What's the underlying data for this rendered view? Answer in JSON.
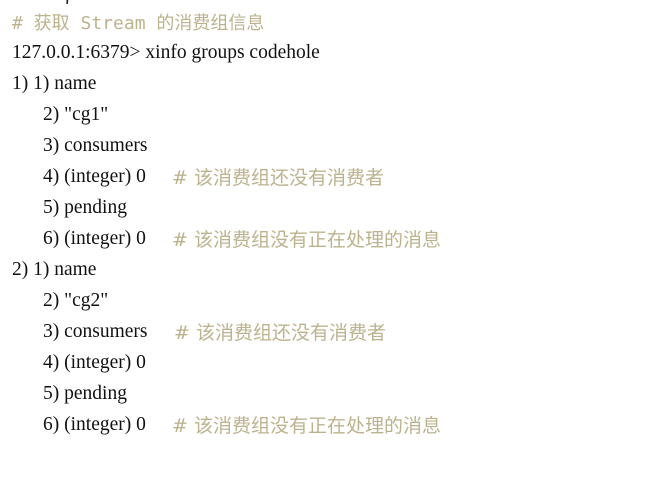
{
  "lines": [
    {
      "indent": 0,
      "text": "",
      "comment": "# 获取 Stream 的消费组信息",
      "comment_gap": 0
    },
    {
      "indent": 0,
      "text": "127.0.0.1:6379> xinfo groups codehole",
      "comment": "",
      "comment_gap": 0
    },
    {
      "indent": 0,
      "text": "1) 1) name",
      "comment": "",
      "comment_gap": 0
    },
    {
      "indent": 1,
      "text": "2) \"cg1\"",
      "comment": "",
      "comment_gap": 0
    },
    {
      "indent": 1,
      "text": "3) consumers",
      "comment": "",
      "comment_gap": 0
    },
    {
      "indent": 1,
      "text": "4) (integer) 0",
      "comment": "# 该消费组还没有消费者",
      "comment_gap": 1
    },
    {
      "indent": 1,
      "text": "5) pending",
      "comment": "",
      "comment_gap": 0
    },
    {
      "indent": 1,
      "text": "6) (integer) 0",
      "comment": "# 该消费组没有正在处理的消息",
      "comment_gap": 1
    },
    {
      "indent": 0,
      "text": "2) 1) name",
      "comment": "",
      "comment_gap": 0
    },
    {
      "indent": 1,
      "text": "2) \"cg2\"",
      "comment": "",
      "comment_gap": 0
    },
    {
      "indent": 1,
      "text": "3) consumers",
      "comment": "# 该消费组还没有消费者",
      "comment_gap": 1
    },
    {
      "indent": 1,
      "text": "4) (integer) 0",
      "comment": "",
      "comment_gap": 0
    },
    {
      "indent": 1,
      "text": "5) pending",
      "comment": "",
      "comment_gap": 0
    },
    {
      "indent": 1,
      "text": "6) (integer) 0",
      "comment": "# 该消费组没有正在处理的消息",
      "comment_gap": 1
    }
  ],
  "colors": {
    "output": "#111111",
    "comment": "#bcb38e",
    "background": "#ffffff"
  }
}
